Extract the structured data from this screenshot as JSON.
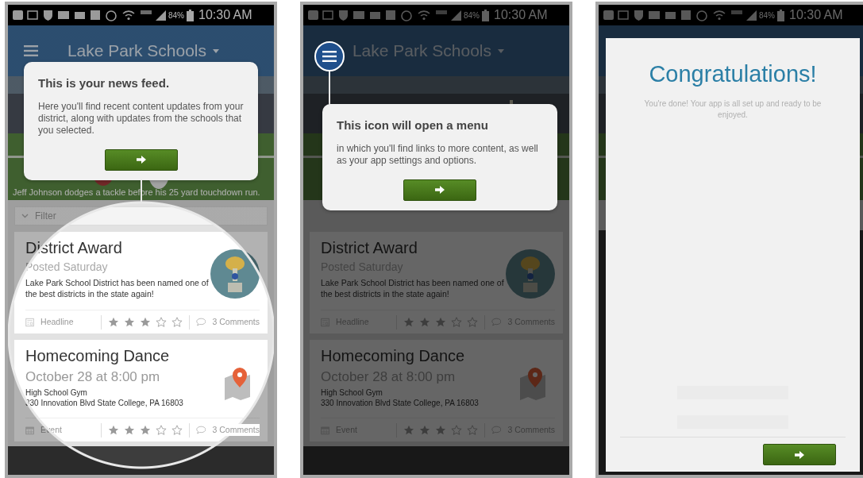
{
  "screens": [
    {
      "status_bar": {
        "battery": "84%",
        "time": "10:30 AM"
      },
      "header": {
        "title": "Lake Park Schools"
      },
      "hero": {
        "caption": "Jeff Johnson dodges a tackle before his 25 yard touchdown run."
      },
      "filter": {
        "label": "Filter"
      },
      "cards": [
        {
          "kind": "headline",
          "title": "District Award",
          "subtitle": "Posted Saturday",
          "text": "Lake Park School District has been named one of the best districts in the state again!",
          "type": "Headline",
          "stars": 3,
          "comments": "3 Comments"
        },
        {
          "kind": "event",
          "title": "Homecoming Dance",
          "subtitle": "October 28 at 8:00 pm",
          "lines": [
            "High School Gym",
            "330 Innovation Blvd State College, PA 16803"
          ],
          "type": "Event",
          "stars": 3,
          "comments": "3 Comments"
        }
      ],
      "overlay": {
        "kind": "spotlight_feed",
        "title": "This is your news feed.",
        "text": "Here you'll find recent content updates from your district, along with updates from the schools that you selected."
      }
    },
    {
      "status_bar": {
        "battery": "84%",
        "time": "10:30 AM"
      },
      "header": {
        "title": "Lake Park Schools"
      },
      "cards": [
        {
          "kind": "headline",
          "title": "District Award",
          "subtitle": "Posted Saturday",
          "text": "Lake Park School District has been named one of the best districts in the state again!",
          "type": "Headline",
          "stars": 3,
          "comments": "3 Comments"
        },
        {
          "kind": "event",
          "title": "Homecoming Dance",
          "subtitle": "October 28 at 8:00 pm",
          "lines": [
            "High School Gym",
            "330 Innovation Blvd State College, PA 16803"
          ],
          "type": "Event",
          "stars": 3,
          "comments": "3 Comments"
        }
      ],
      "overlay": {
        "kind": "spotlight_menu",
        "title": "This icon will open a menu",
        "text": "in which you'll find links to more content, as well as your app settings and options."
      }
    },
    {
      "status_bar": {
        "battery": "84%",
        "time": "10:30 AM"
      },
      "overlay": {
        "kind": "modal",
        "title": "Congratulations!",
        "text": "You're done! Your app is all set up and ready to be enjoyed."
      }
    }
  ]
}
